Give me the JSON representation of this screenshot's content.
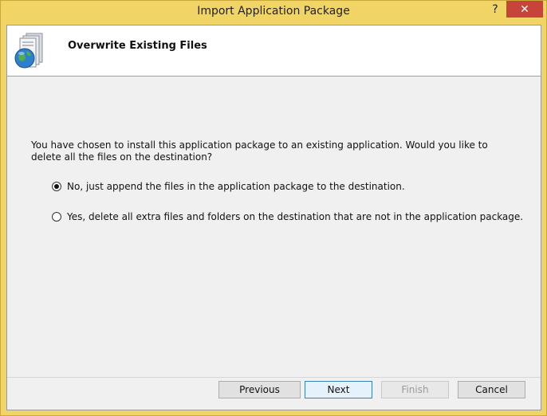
{
  "window": {
    "title": "Import Application Package",
    "help_glyph": "?",
    "close_glyph": "✕"
  },
  "header": {
    "title": "Overwrite Existing Files",
    "icon": "package-globe-icon"
  },
  "content": {
    "prompt": "You have chosen to install this application package to an existing application. Would you like to delete all the files on the destination?",
    "options": [
      {
        "label": "No, just append the files in the application package to the destination.",
        "selected": true
      },
      {
        "label": "Yes, delete all extra files and folders on the destination that are not in the application package.",
        "selected": false
      }
    ]
  },
  "buttons": {
    "previous": "Previous",
    "next": "Next",
    "finish": "Finish",
    "cancel": "Cancel"
  },
  "colors": {
    "frame": "#f0d466",
    "close": "#c7443b",
    "client_bg": "#f0f0f0"
  }
}
